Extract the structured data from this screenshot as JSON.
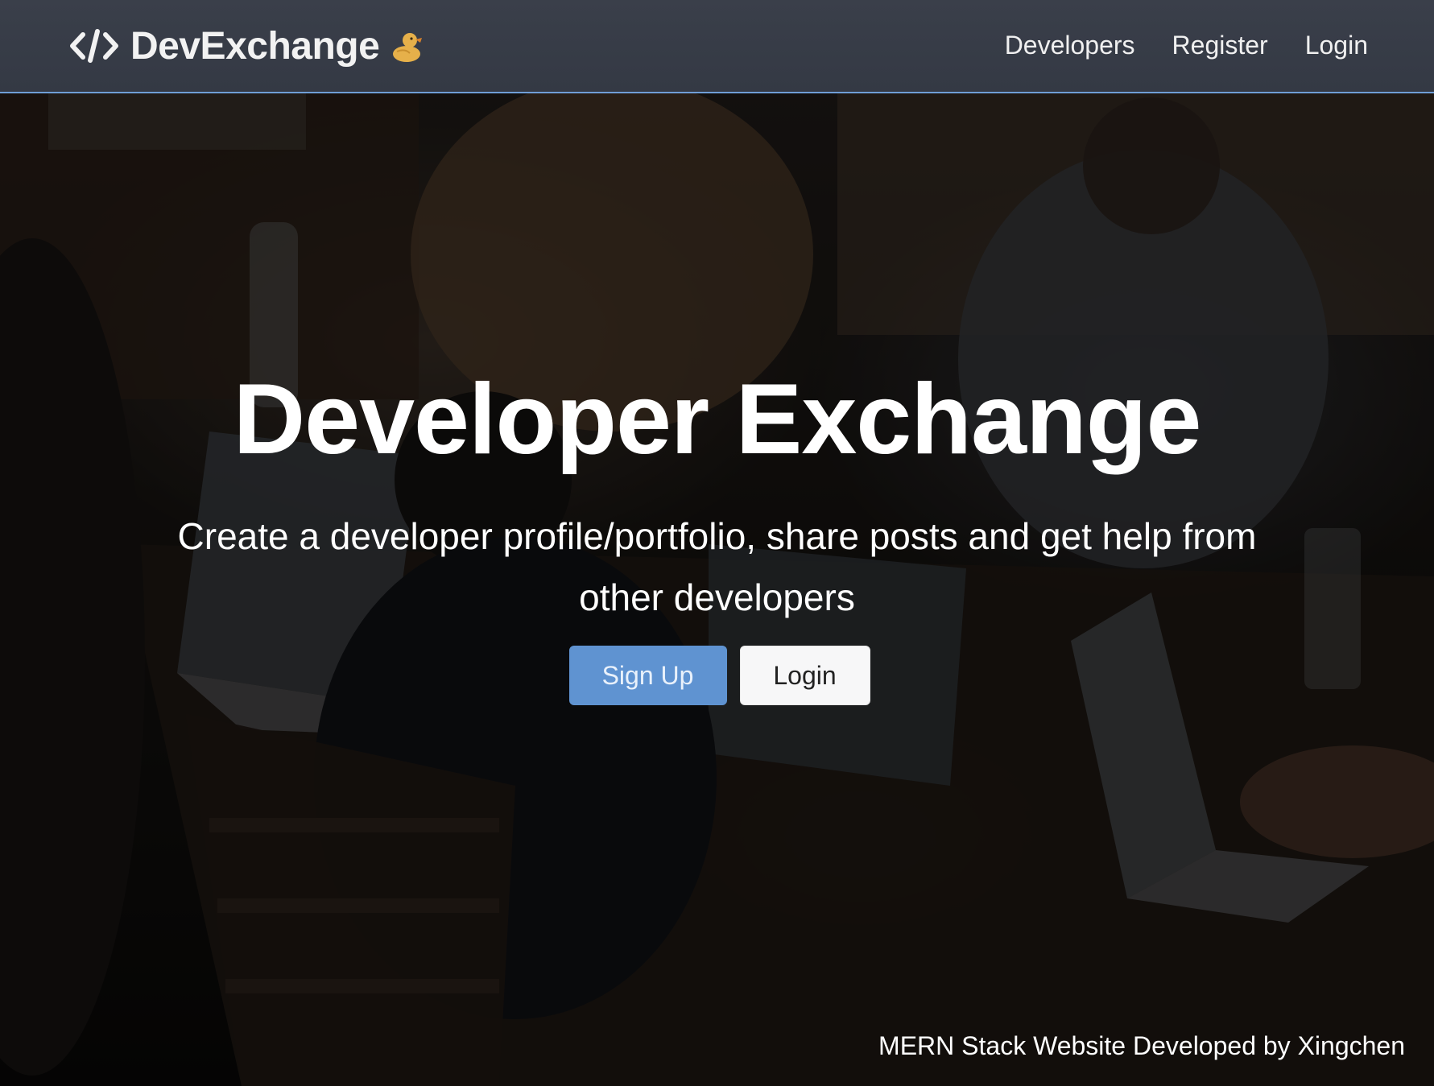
{
  "navbar": {
    "brand": {
      "icon": "code-icon",
      "name": "DevExchange",
      "emoji_icon": "duck-icon"
    },
    "links": [
      {
        "label": "Developers"
      },
      {
        "label": "Register"
      },
      {
        "label": "Login"
      }
    ],
    "border_color": "#6f9ed6",
    "background": "#3a3f4a"
  },
  "hero": {
    "title": "Developer Exchange",
    "subtitle": "Create a developer profile/portfolio, share posts and get help from other developers",
    "buttons": {
      "signup_label": "Sign Up",
      "login_label": "Login"
    },
    "credit": "MERN Stack Website Developed by Xingchen"
  },
  "colors": {
    "primary": "#5f93d1",
    "light_button": "#f7f7f8",
    "text": "#ffffff"
  }
}
